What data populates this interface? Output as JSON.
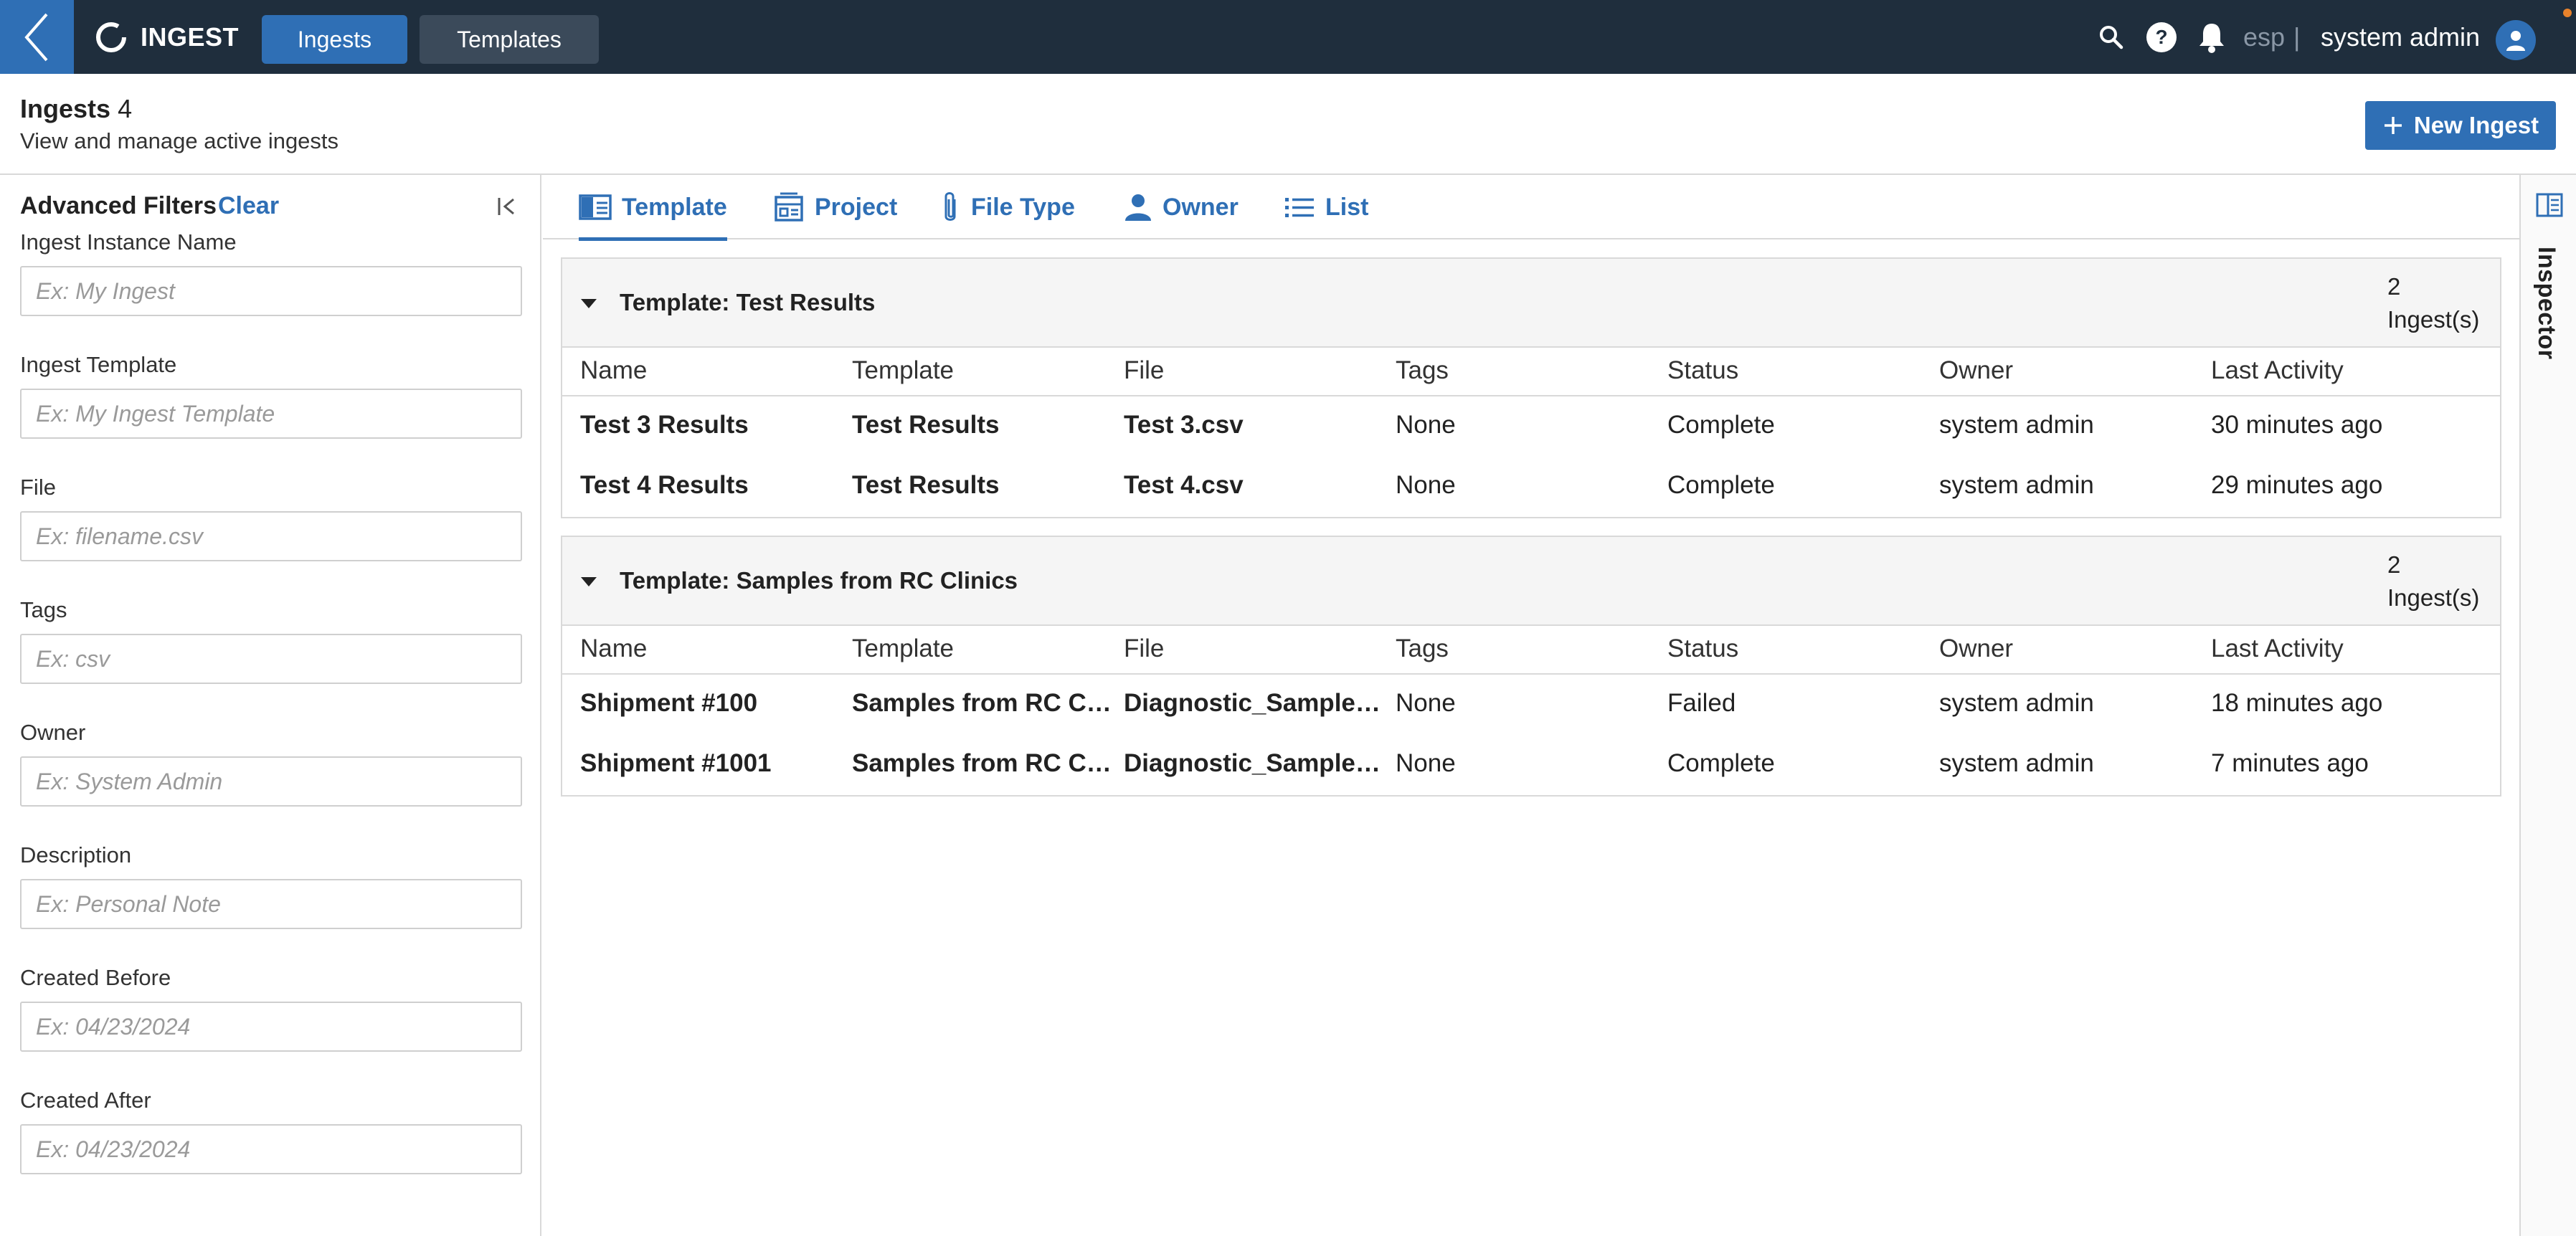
{
  "app": {
    "name": "INGEST"
  },
  "nav": {
    "tabs": [
      {
        "label": "Ingests"
      },
      {
        "label": "Templates"
      }
    ]
  },
  "topbar": {
    "workspace": "esp",
    "separator": "|",
    "user": "system admin"
  },
  "header": {
    "title": "Ingests",
    "count": "4",
    "subtitle": "View and manage active ingests",
    "new_button": "New Ingest"
  },
  "filters": {
    "title": "Advanced Filters",
    "clear": "Clear",
    "fields": [
      {
        "label": "Ingest Instance Name",
        "placeholder": "Ex: My Ingest"
      },
      {
        "label": "Ingest Template",
        "placeholder": "Ex: My Ingest Template"
      },
      {
        "label": "File",
        "placeholder": "Ex: filename.csv"
      },
      {
        "label": "Tags",
        "placeholder": "Ex: csv"
      },
      {
        "label": "Owner",
        "placeholder": "Ex: System Admin"
      },
      {
        "label": "Description",
        "placeholder": "Ex: Personal Note"
      },
      {
        "label": "Created Before",
        "placeholder": "Ex: 04/23/2024"
      },
      {
        "label": "Created After",
        "placeholder": "Ex: 04/23/2024"
      }
    ]
  },
  "group_tabs": [
    {
      "label": "Template",
      "icon": "template-icon"
    },
    {
      "label": "Project",
      "icon": "project-icon"
    },
    {
      "label": "File Type",
      "icon": "paperclip-icon"
    },
    {
      "label": "Owner",
      "icon": "person-icon"
    },
    {
      "label": "List",
      "icon": "list-icon"
    }
  ],
  "columns": [
    "Name",
    "Template",
    "File",
    "Tags",
    "Status",
    "Owner",
    "Last Activity"
  ],
  "groups": [
    {
      "title": "Template: Test Results",
      "count": "2",
      "count_unit": "Ingest(s)",
      "rows": [
        {
          "name": "Test 3 Results",
          "template": "Test Results",
          "file": "Test 3.csv",
          "tags": "None",
          "status": "Complete",
          "owner": "system admin",
          "last_activity": "30 minutes ago"
        },
        {
          "name": "Test 4 Results",
          "template": "Test Results",
          "file": "Test 4.csv",
          "tags": "None",
          "status": "Complete",
          "owner": "system admin",
          "last_activity": "29 minutes ago"
        }
      ]
    },
    {
      "title": "Template: Samples from RC Clinics",
      "count": "2",
      "count_unit": "Ingest(s)",
      "rows": [
        {
          "name": "Shipment #100",
          "template": "Samples from RC Clinics",
          "file": "Diagnostic_Samples.csv",
          "tags": "None",
          "status": "Failed",
          "owner": "system admin",
          "last_activity": "18 minutes ago"
        },
        {
          "name": "Shipment #1001",
          "template": "Samples from RC Clinics",
          "file": "Diagnostic_Samples.csv",
          "tags": "None",
          "status": "Complete",
          "owner": "system admin",
          "last_activity": "7 minutes ago"
        }
      ]
    }
  ],
  "inspector": {
    "label": "Inspector"
  },
  "colors": {
    "topbar": "#1f2e3d",
    "accent": "#2f6fb5",
    "notification": "#e8822b"
  }
}
